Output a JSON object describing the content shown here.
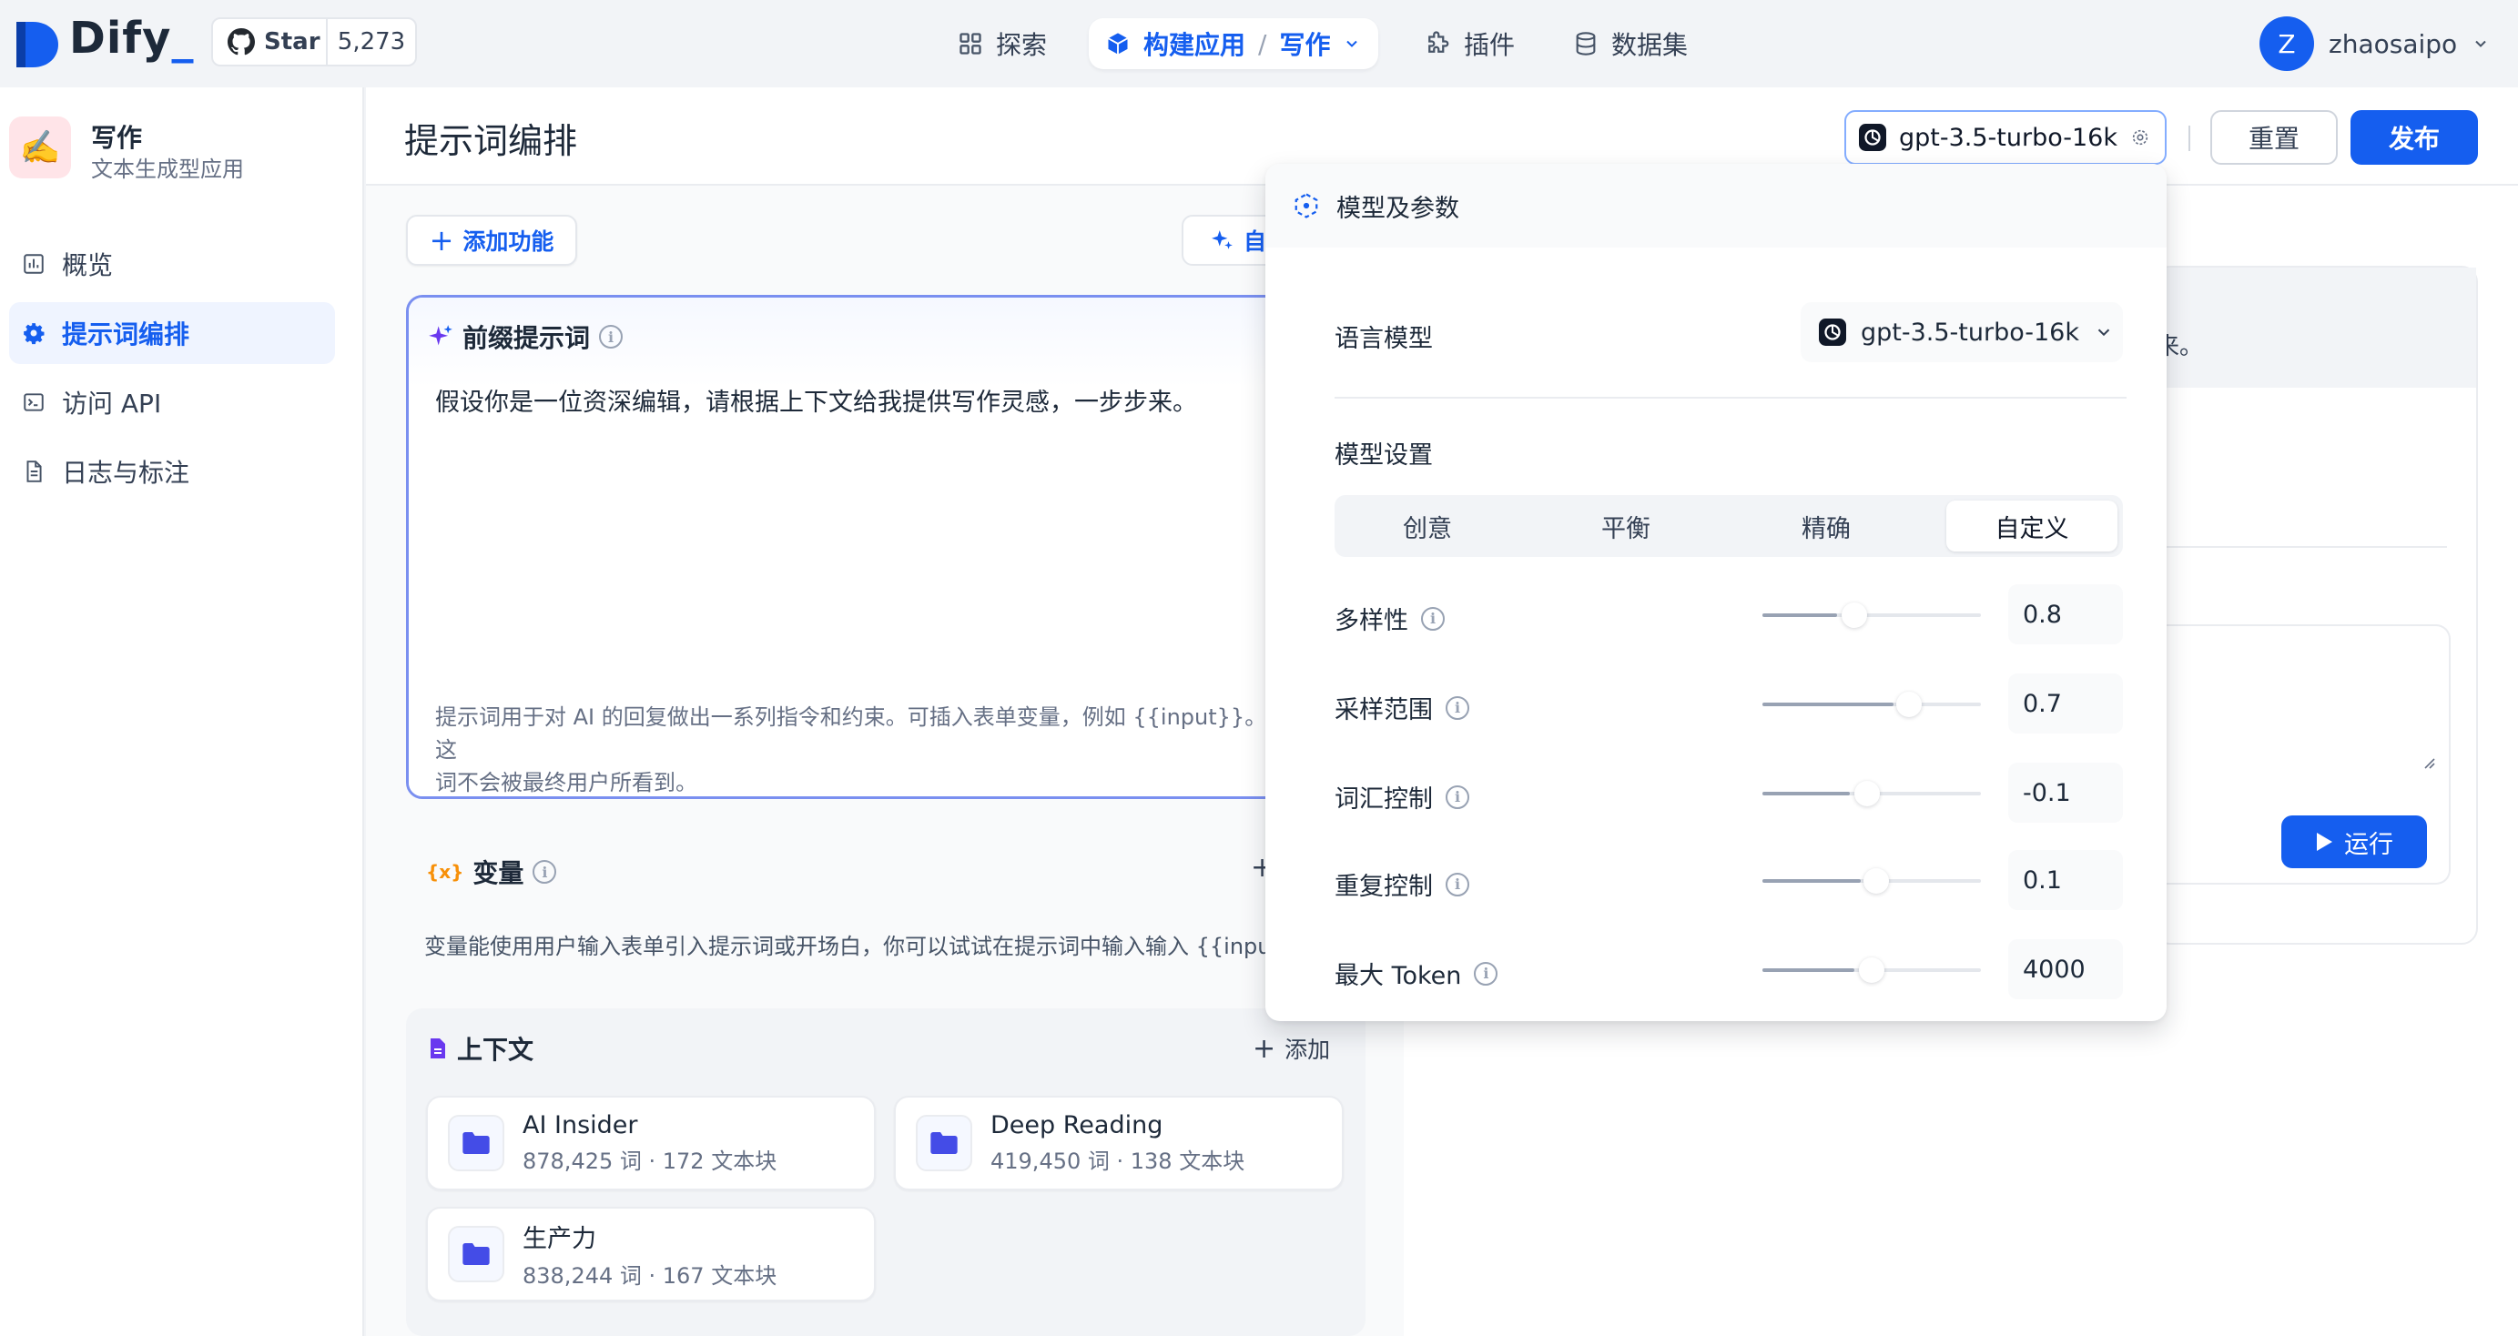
{
  "topbar": {
    "brand": "Dify",
    "brand_cursor": "_",
    "star_label": "Star",
    "star_count": "5,273",
    "nav": {
      "explore": "探索",
      "build": "构建应用",
      "separator": "/",
      "current_app": "写作",
      "plugins": "插件",
      "datasets": "数据集"
    },
    "user": {
      "initial": "Z",
      "name": "zhaosaipo"
    }
  },
  "sidebar": {
    "app_icon": "✍️",
    "app_name": "写作",
    "app_type": "文本生成型应用",
    "items": [
      {
        "label": "概览",
        "icon": "chart-icon"
      },
      {
        "label": "提示词编排",
        "icon": "gear-icon",
        "active": true
      },
      {
        "label": "访问 API",
        "icon": "terminal-icon"
      },
      {
        "label": "日志与标注",
        "icon": "document-icon"
      }
    ]
  },
  "header": {
    "title": "提示词编排",
    "model_button": "gpt-3.5-turbo-16k",
    "reset": "重置",
    "publish": "发布"
  },
  "toolbar": {
    "add_feature": "添加功能",
    "auto_partial": "自"
  },
  "prompt": {
    "title": "前缀提示词",
    "text": "假设你是一位资深编辑，请根据上下文给我提供写作灵感，一步步来。",
    "hint_line1": "提示词用于对 AI 的回复做出一系列指令和约束。可插入表单变量，例如 {{input}}。这",
    "hint_line2": "词不会被最终用户所看到。"
  },
  "variables": {
    "icon_text": "{x}",
    "title": "变量",
    "desc": "变量能使用用户输入表单引入提示词或开场白，你可以试试在提示词中输入输入 {{input}}"
  },
  "context": {
    "title": "上下文",
    "add": "添加",
    "datasets": [
      {
        "name": "AI Insider",
        "meta": "878,425 词 · 172 文本块"
      },
      {
        "name": "Deep Reading",
        "meta": "419,450 词 · 138 文本块"
      },
      {
        "name": "生产力",
        "meta": "838,244 词 · 167 文本块"
      }
    ]
  },
  "debug": {
    "fragment": "来。",
    "run": "运行"
  },
  "popover": {
    "title": "模型及参数",
    "language_model_label": "语言模型",
    "language_model_value": "gpt-3.5-turbo-16k",
    "settings_label": "模型设置",
    "presets": [
      "创意",
      "平衡",
      "精确",
      "自定义"
    ],
    "active_preset": "自定义",
    "params": [
      {
        "label": "多样性",
        "value": "0.8",
        "fill": 0.34,
        "thumb": 0.42
      },
      {
        "label": "采样范围",
        "value": "0.7",
        "fill": 0.6,
        "thumb": 0.67
      },
      {
        "label": "词汇控制",
        "value": "-0.1",
        "fill": 0.4,
        "thumb": 0.48
      },
      {
        "label": "重复控制",
        "value": "0.1",
        "fill": 0.45,
        "thumb": 0.52
      },
      {
        "label": "最大 Token",
        "value": "4000",
        "fill": 0.42,
        "thumb": 0.5
      }
    ]
  },
  "colors": {
    "accent": "#155eef",
    "prompt_border": "#7a8ff0",
    "folder": "#444ce7"
  }
}
